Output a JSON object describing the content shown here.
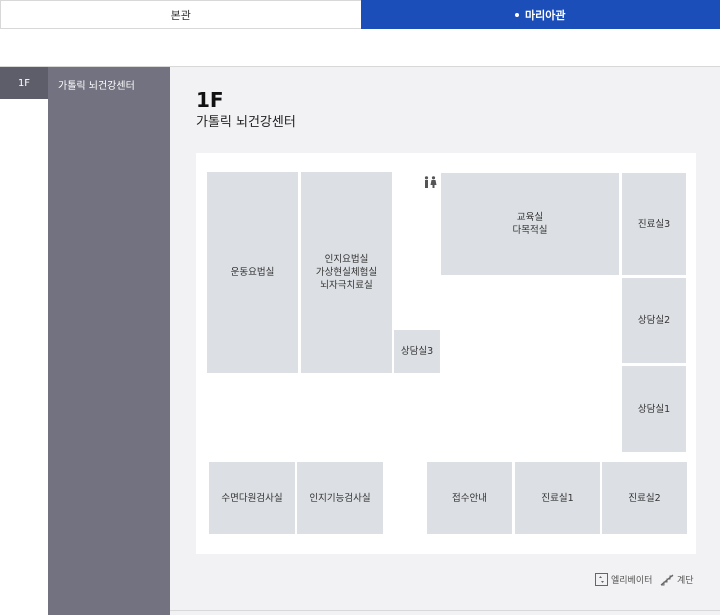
{
  "tabs": {
    "main_building": "본관",
    "maria_building": "마리아관"
  },
  "floor": {
    "selected_floor": "1F",
    "menu_item": "가톨릭 뇌건강센터",
    "title": "1F",
    "subtitle": "가톨릭 뇌건강센터"
  },
  "rooms": {
    "exercise_therapy": "운동요법실",
    "cognitive_therapy": "인지요법실\n가상현실체험실\n뇌자극치료실",
    "counseling_3": "상담실3",
    "education": "교육실\n다목적실",
    "clinic_3": "진료실3",
    "counseling_2": "상담실2",
    "counseling_1": "상담실1",
    "sleep_test": "수면다원검사실",
    "cognitive_test": "인지기능검사실",
    "reception": "접수안내",
    "clinic_1": "진료실1",
    "clinic_2": "진료실2"
  },
  "legend": {
    "elevator": "엘리베이터",
    "stairs": "계단"
  },
  "icons": {
    "restroom": "restroom-icon",
    "elevator": "elevator-icon",
    "stairs": "stairs-icon"
  },
  "colors": {
    "active_tab": "#1b4eb8",
    "side_panel": "#727280",
    "room_fill": "#dcdfe3"
  }
}
